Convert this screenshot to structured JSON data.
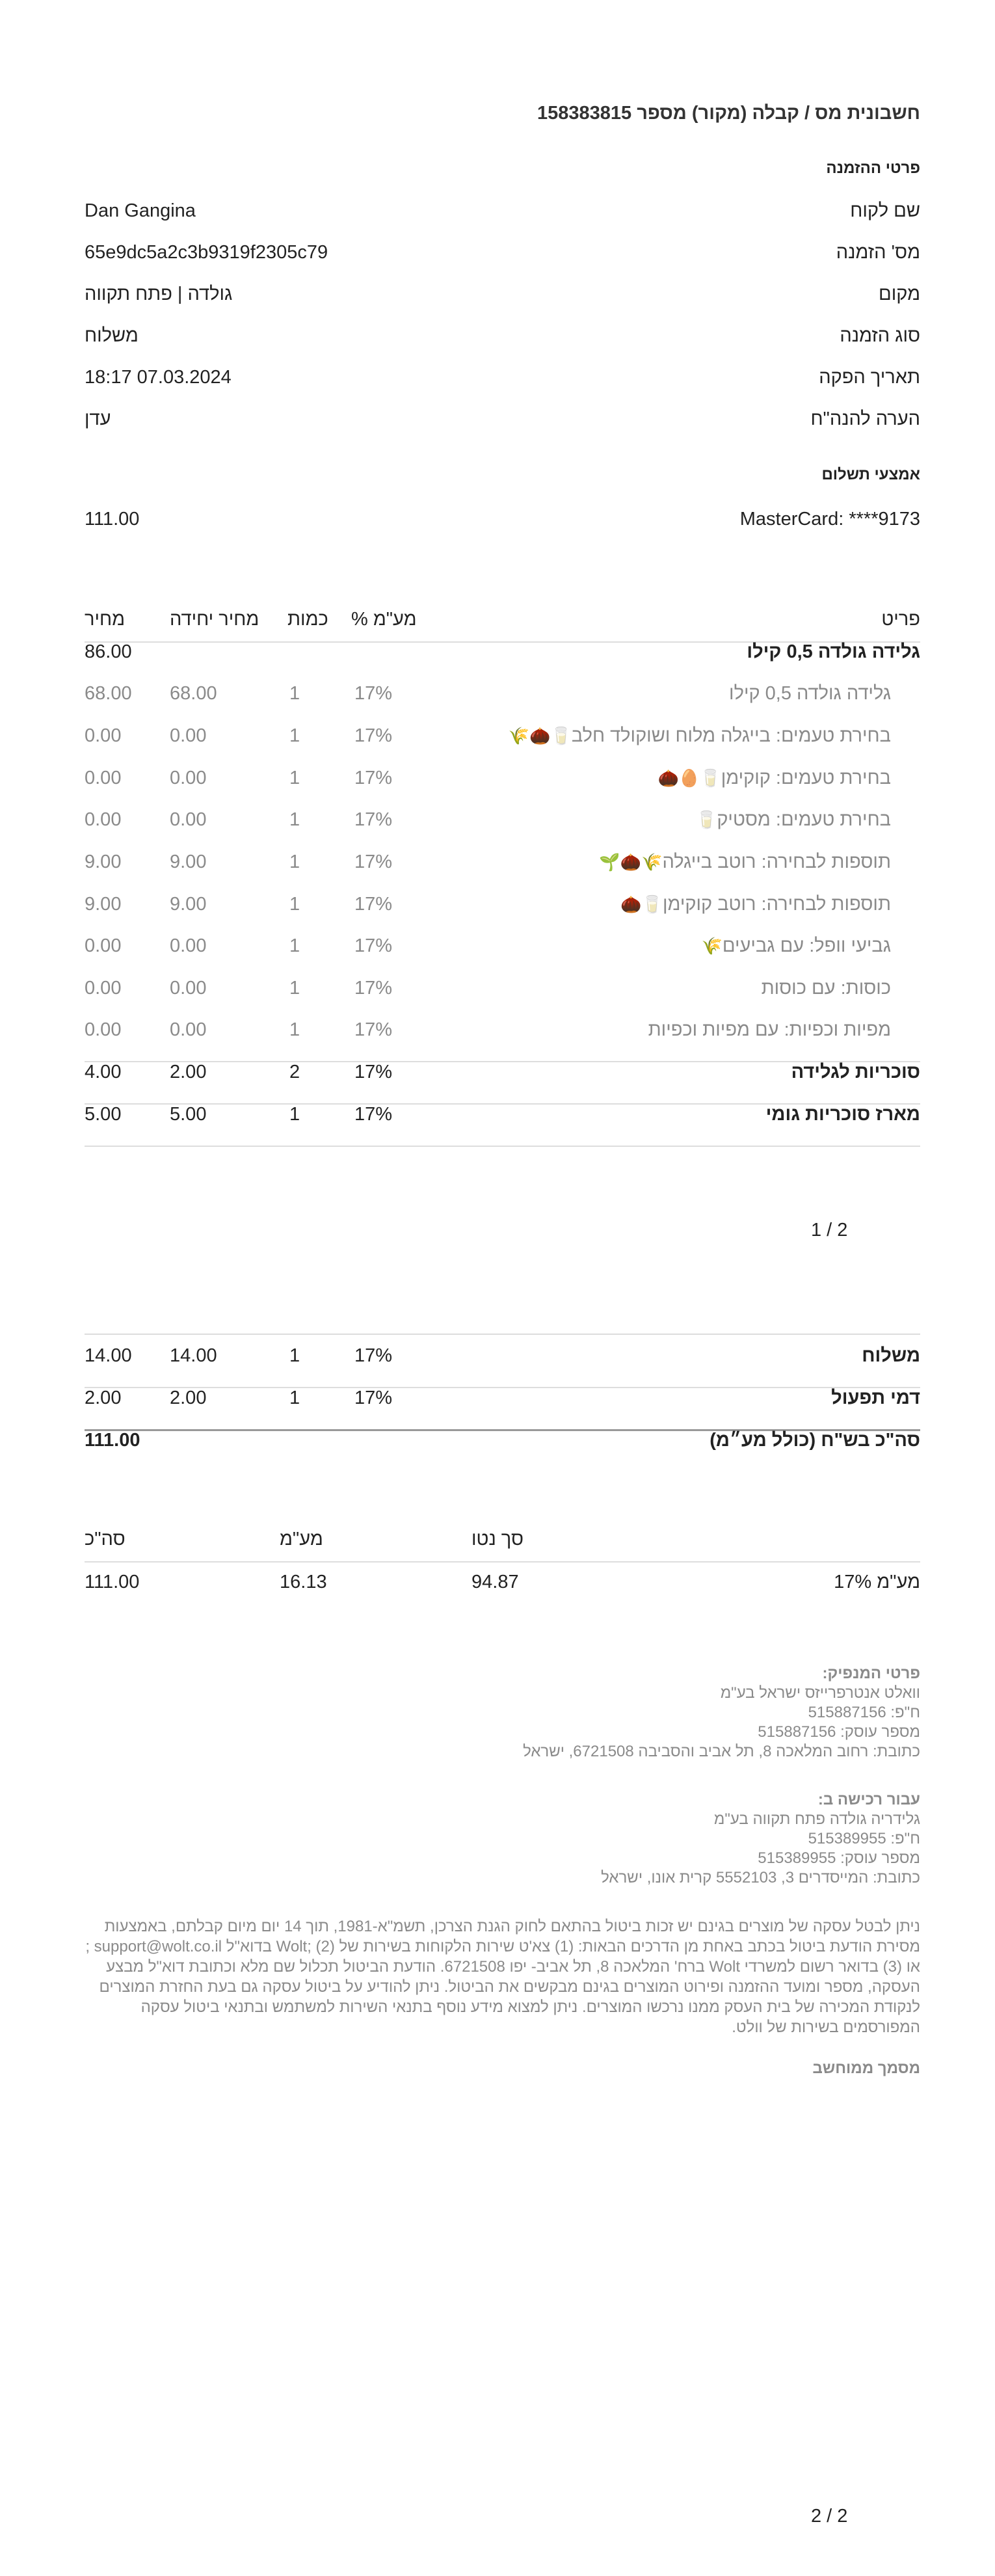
{
  "header": {
    "title": "חשבונית מס / קבלה (מקור) מספר 158383815"
  },
  "order_details": {
    "heading": "פרטי ההזמנה",
    "rows": [
      {
        "label": "שם לקוח",
        "value": "Dan Gangina"
      },
      {
        "label": "מס' הזמנה",
        "value": "65e9dc5a2c3b9319f2305c79"
      },
      {
        "label": "מקום",
        "value": "גולדה | פתח תקווה"
      },
      {
        "label": "סוג הזמנה",
        "value": "משלוח"
      },
      {
        "label": "תאריך הפקה",
        "value": "18:17 07.03.2024"
      },
      {
        "label": "הערה להנה\"ח",
        "value": "עדן"
      }
    ]
  },
  "payment": {
    "heading": "אמצעי תשלום",
    "method": "MasterCard: ****9173",
    "amount": "111.00"
  },
  "items_table": {
    "headers": {
      "item": "פריט",
      "vat": "מע\"מ %",
      "qty": "כמות",
      "unit_price": "מחיר יחידה",
      "price": "מחיר"
    },
    "rows": [
      {
        "item": "גלידה גולדה 0,5 קילו",
        "vat": "",
        "qty": "",
        "unit": "",
        "price": "86.00",
        "style": "main"
      },
      {
        "item": "גלידה גולדה 0,5 קילו",
        "vat": "17%",
        "qty": "1",
        "unit": "68.00",
        "price": "68.00",
        "style": "sub",
        "emoji": ""
      },
      {
        "item": "בחירת טעמים: בייגלה מלוח ושוקולד חלב",
        "vat": "17%",
        "qty": "1",
        "unit": "0.00",
        "price": "0.00",
        "style": "sub",
        "emoji": "🥛🌰🌾"
      },
      {
        "item": "בחירת טעמים: קוקימן",
        "vat": "17%",
        "qty": "1",
        "unit": "0.00",
        "price": "0.00",
        "style": "sub",
        "emoji": "🥛🥚🌰"
      },
      {
        "item": "בחירת טעמים: מסטיק",
        "vat": "17%",
        "qty": "1",
        "unit": "0.00",
        "price": "0.00",
        "style": "sub",
        "emoji": "🥛"
      },
      {
        "item": "תוספות לבחירה: רוטב בייגלה",
        "vat": "17%",
        "qty": "1",
        "unit": "9.00",
        "price": "9.00",
        "style": "sub",
        "emoji": "🌾🌰🌱"
      },
      {
        "item": "תוספות לבחירה: רוטב קוקימן",
        "vat": "17%",
        "qty": "1",
        "unit": "9.00",
        "price": "9.00",
        "style": "sub",
        "emoji": "🥛🌰"
      },
      {
        "item": "גביעי וופל: עם גביעים",
        "vat": "17%",
        "qty": "1",
        "unit": "0.00",
        "price": "0.00",
        "style": "sub",
        "emoji": "🌾"
      },
      {
        "item": "כוסות: עם כוסות",
        "vat": "17%",
        "qty": "1",
        "unit": "0.00",
        "price": "0.00",
        "style": "sub",
        "emoji": ""
      },
      {
        "item": "מפיות וכפיות: עם מפיות וכפיות",
        "vat": "17%",
        "qty": "1",
        "unit": "0.00",
        "price": "0.00",
        "style": "sub",
        "emoji": ""
      },
      {
        "item": "סוכריות לגלידה",
        "vat": "17%",
        "qty": "2",
        "unit": "2.00",
        "price": "4.00",
        "style": "main"
      },
      {
        "item": "מארז סוכריות גומי",
        "vat": "17%",
        "qty": "1",
        "unit": "5.00",
        "price": "5.00",
        "style": "main"
      }
    ]
  },
  "page1_number": "1 / 2",
  "extra_rows": [
    {
      "item": "משלוח",
      "vat": "17%",
      "qty": "1",
      "unit": "14.00",
      "price": "14.00"
    },
    {
      "item": "דמי תפעול",
      "vat": "17%",
      "qty": "1",
      "unit": "2.00",
      "price": "2.00"
    }
  ],
  "grand_total": {
    "label": "סה\"כ בש\"ח (כולל מע״מ)",
    "value": "111.00"
  },
  "vat_summary": {
    "headers": {
      "net": "סך נטו",
      "vat": "מע\"מ",
      "total": "סה\"כ"
    },
    "row": {
      "label": "מע\"מ 17%",
      "net": "94.87",
      "vat": "16.13",
      "total": "111.00"
    }
  },
  "supplier": {
    "title": "פרטי המנפיק:",
    "lines": [
      "וואלט אנטרפרייזס ישראל בע\"מ",
      "ח\"פ: 515887156",
      "מספר עוסק: 515887156",
      "כתובת: רחוב המלאכה 8, תל אביב והסביבה 6721508, ישראל"
    ]
  },
  "received_for": {
    "title": "עבור רכישה ב:",
    "lines": [
      "גלידריה גולדה פתח תקווה בע\"מ",
      "ח\"פ: 515389955",
      "מספר עוסק: 515389955",
      "כתובת: המייסדרים 3, 5552103 קרית אונו, ישראל"
    ]
  },
  "legal_text": "ניתן לבטל עסקה של מוצרים בגינם יש זכות ביטול בהתאם לחוק הגנת הצרכן, תשמ\"א-1981, תוך 14 יום מיום קבלתם, באמצעות מסירת הודעת ביטול בכתב באחת מן הדרכים הבאות: (1) צא'ט שירות הלקוחות בשירות של Wolt; (2) בדוא\"ל support@wolt.co.il ; או (3) בדואר רשום למשרדי Wolt ברח' המלאכה 8, תל אביב- יפו 6721508. הודעת הביטול תכלול שם מלא וכתובת דוא\"ל מבצע העסקה, מספר ומועד ההזמנה ופירוט המוצרים בגינם מבקשים את הביטול. ניתן להודיע על ביטול עסקה גם בעת החזרת המוצרים לנקודת המכירה של בית העסק ממנו נרכשו המוצרים. ניתן למצוא מידע נוסף בתנאי השירות למשתמש ובתנאי ביטול עסקה המפורסמים בשירות של וולט.",
  "computerized_doc": "מסמך ממוחשב",
  "page2_number": "2 / 2"
}
